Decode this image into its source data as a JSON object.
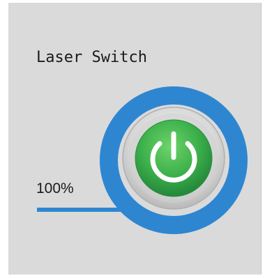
{
  "laser": {
    "title": "Laser Switch",
    "power_label": "100%",
    "power_fraction": 1.0,
    "state": "on"
  },
  "colors": {
    "panel_bg": "#dadada",
    "accent_blue": "#2e86d1",
    "button_green": "#3eb24c",
    "icon_white": "#ffffff"
  },
  "icons": {
    "power_button": "power-icon"
  }
}
